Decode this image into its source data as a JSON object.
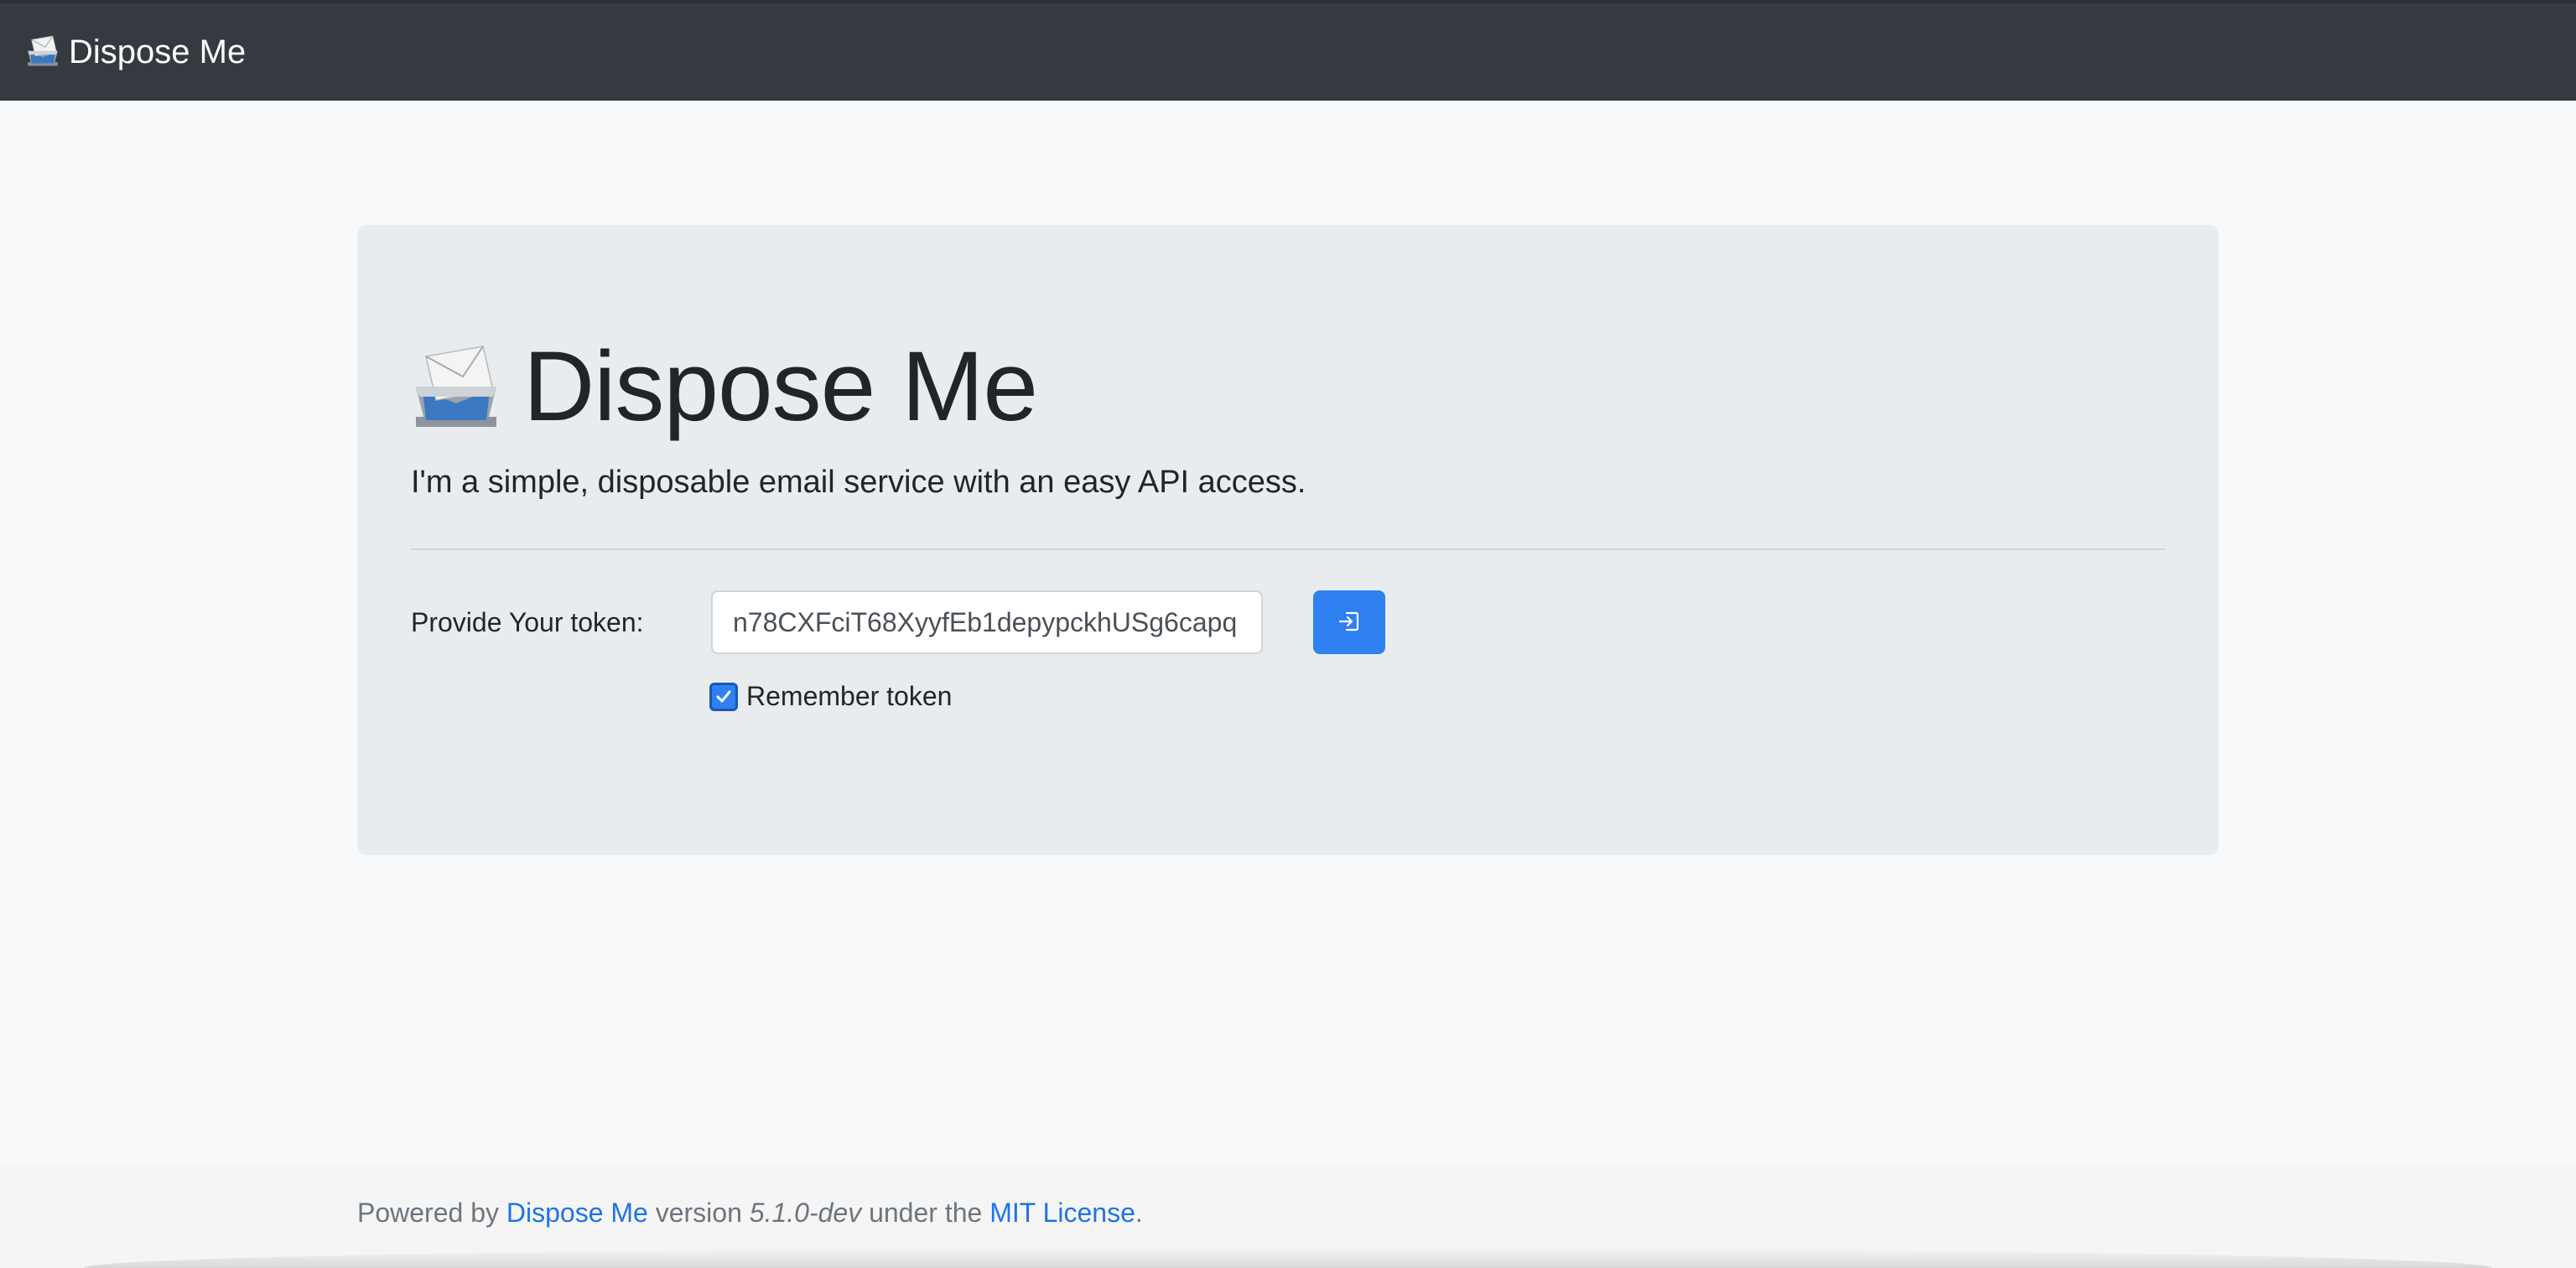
{
  "navbar": {
    "brand_label": "Dispose Me",
    "brand_icon": "inbox-tray-icon"
  },
  "hero": {
    "title": "Dispose Me",
    "icon": "inbox-tray-icon",
    "lead": "I'm a simple, disposable email service with an easy API access."
  },
  "token_form": {
    "label": "Provide Your token:",
    "token_value": "n78CXFciT68XyyfEb1depypckhUSg6capq",
    "submit_icon": "sign-in-icon",
    "remember_label": "Remember token",
    "remember_checked": true
  },
  "footer": {
    "powered_by": "Powered by",
    "project_link": "Dispose Me",
    "version_text": "version",
    "version": "5.1.0-dev",
    "under_text": "under the",
    "license_link": "MIT License",
    "period": "."
  },
  "colors": {
    "navbar_bg": "#343a40",
    "page_bg": "#f8f9fa",
    "card_bg": "#e9ecef",
    "accent": "#2f80f0",
    "link": "#1e73e8"
  }
}
